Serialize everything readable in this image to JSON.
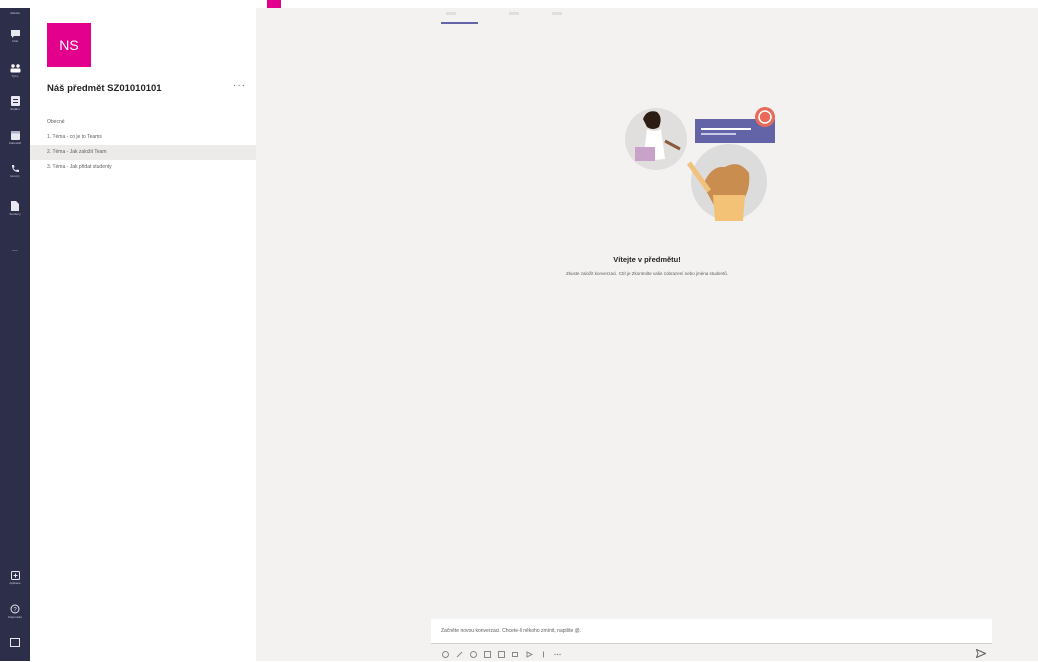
{
  "colors": {
    "rail": "#2c2e4a",
    "accent": "#e3008c",
    "brand": "#6264a7",
    "canvas": "#f3f2f1"
  },
  "rail": {
    "items": [
      {
        "label": "Aktivita",
        "icon": "bell-icon"
      },
      {
        "label": "Chat",
        "icon": "chat-icon"
      },
      {
        "label": "Týmy",
        "icon": "teams-icon"
      },
      {
        "label": "Zadání",
        "icon": "assignments-icon"
      },
      {
        "label": "Kalendář",
        "icon": "calendar-icon"
      },
      {
        "label": "Hovory",
        "icon": "phone-icon"
      },
      {
        "label": "Soubory",
        "icon": "files-icon"
      },
      {
        "label": "...",
        "icon": "more-icon"
      }
    ],
    "bottom_items": [
      {
        "label": "Aplikace",
        "icon": "apps-icon"
      },
      {
        "label": "Nápověda",
        "icon": "help-icon"
      },
      {
        "label": "",
        "icon": "feedback-icon"
      }
    ]
  },
  "team": {
    "avatar_initials": "NS",
    "name": "Náš předmět SZ01010101",
    "more": "···",
    "channels": [
      {
        "label": "Obecné",
        "active": false
      },
      {
        "label": "1. Téma - co je to Teams",
        "active": false
      },
      {
        "label": "2. Téma - Jak založit Team",
        "active": true
      },
      {
        "label": "3. Téma - Jak přidat studenty",
        "active": false
      }
    ]
  },
  "main": {
    "welcome_title": "Vítejte v předmětu!",
    "welcome_text": "Zkuste založit konverzaci. Ctít je Zkontrolte vaše zobrazení nebo jména studentů.",
    "compose_placeholder": "Začněte novou konverzaci. Chcete-li někoho zmínit, napište @.",
    "send_icon": "send-icon"
  }
}
